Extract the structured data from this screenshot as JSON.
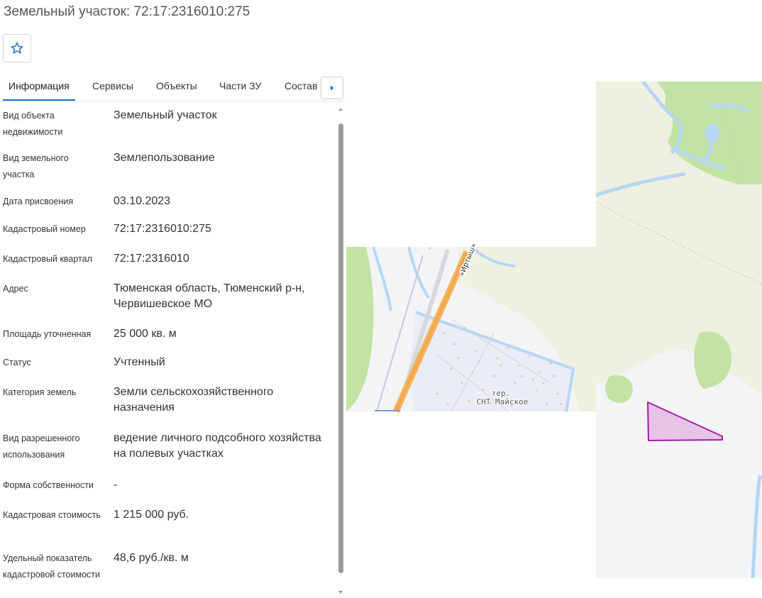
{
  "page": {
    "title": "Земельный участок: 72:17:2316010:275"
  },
  "toolbar": {
    "favorite_icon": "star-outline-icon"
  },
  "tabs": [
    {
      "label": "Информация",
      "active": true
    },
    {
      "label": "Сервисы",
      "active": false
    },
    {
      "label": "Объекты",
      "active": false
    },
    {
      "label": "Части ЗУ",
      "active": false
    },
    {
      "label": "Состав",
      "active": false
    }
  ],
  "tabs_next_icon": "caret-right-icon",
  "properties": [
    {
      "label": "Вид объекта недвижимости",
      "value": "Земельный участок"
    },
    {
      "label": "Вид земельного участка",
      "value": "Землепользование"
    },
    {
      "label": "Дата присвоения",
      "value": "03.10.2023"
    },
    {
      "label": "Кадастровый номер",
      "value": "72:17:2316010:275"
    },
    {
      "label": "Кадастровый квартал",
      "value": "72:17:2316010"
    },
    {
      "label": "Адрес",
      "value": "Тюменская область, Тюменский р-н, Червишевское МО"
    },
    {
      "label": "Площадь уточненная",
      "value": "25 000 кв. м"
    },
    {
      "label": "Статус",
      "value": "Учтенный"
    },
    {
      "label": "Категория земель",
      "value": "Земли сельскохозяйственного назначения"
    },
    {
      "label": "Вид разрешенного использования",
      "value": "ведение личного подсобного хозяйства на полевых участках"
    },
    {
      "label": "Форма собственности",
      "value": "-"
    },
    {
      "label": "Кадастровая стоимость",
      "value": "1 215 000 руб."
    },
    {
      "label": "Удельный показатель кадастровой стоимости",
      "value": "48,6 руб./кв. м"
    }
  ],
  "map": {
    "road_label": "«Иртыш»",
    "settlement_label_line1": "тер.",
    "settlement_label_line2": "СНТ Майское",
    "colors": {
      "parcel_fill": "#e7c3e6",
      "parcel_stroke": "#a51fa8",
      "forest": "#c2e3a4",
      "field": "#eef0e0",
      "water": "#b6d7f5",
      "road": "#f6b159",
      "base": "#f3f4f5"
    }
  }
}
